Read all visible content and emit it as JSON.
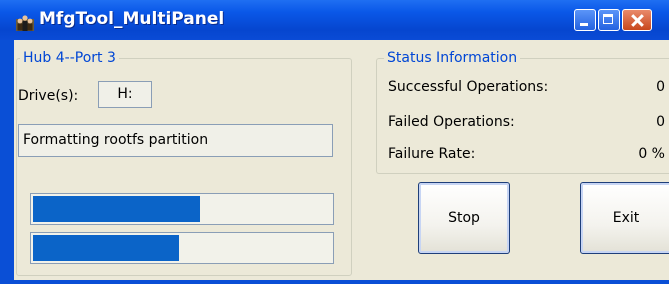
{
  "window": {
    "title": "MfgTool_MultiPanel",
    "icon": "people-icon",
    "controls": [
      "minimize-icon",
      "maximize-icon",
      "close-icon"
    ]
  },
  "hub": {
    "label": "Hub 4--Port 3",
    "drive_label": "Drive(s):",
    "drive_value": "H:",
    "status_text": "Formatting rootfs partition",
    "progress": [
      0.56,
      0.49
    ]
  },
  "status": {
    "label": "Status Information",
    "successful_label": "Successful Operations:",
    "successful_value": "0",
    "failed_label": "Failed Operations:",
    "failed_value": "0",
    "failure_rate_label": "Failure Rate:",
    "failure_rate_value": "0 %"
  },
  "buttons": {
    "stop": "Stop",
    "exit": "Exit"
  },
  "colors": {
    "titlebar": "#0a4fd6",
    "group_label": "#0046d5",
    "progress_fill": "#0b64c8",
    "client_bg": "#ece9d8"
  }
}
